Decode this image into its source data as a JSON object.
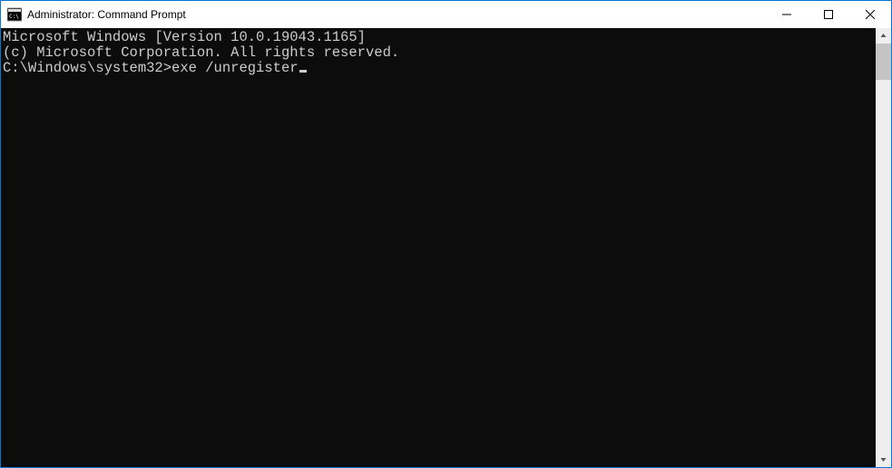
{
  "window": {
    "title": "Administrator: Command Prompt"
  },
  "console": {
    "line1": "Microsoft Windows [Version 10.0.19043.1165]",
    "line2": "(c) Microsoft Corporation. All rights reserved.",
    "blank": "",
    "prompt": "C:\\Windows\\system32>",
    "command": "exe /unregister"
  }
}
